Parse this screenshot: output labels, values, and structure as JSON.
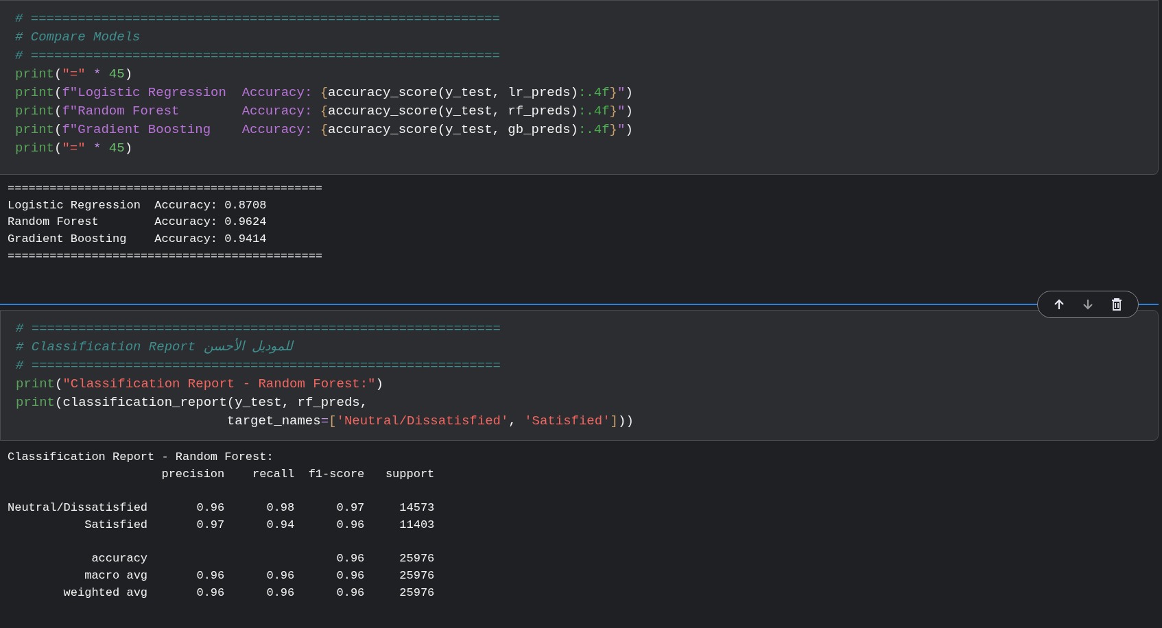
{
  "cells": [
    {
      "selected": false,
      "code": [
        [
          {
            "kind": "comment",
            "text": "# ============================================================"
          }
        ],
        [
          {
            "kind": "comment",
            "text": "# Compare Models"
          }
        ],
        [
          {
            "kind": "comment",
            "text": "# ============================================================"
          }
        ],
        [
          {
            "kind": "func",
            "text": "print"
          },
          {
            "kind": "plain",
            "text": "("
          },
          {
            "kind": "string",
            "text": "\"=\""
          },
          {
            "kind": "operator",
            "text": " * "
          },
          {
            "kind": "number",
            "text": "45"
          },
          {
            "kind": "plain",
            "text": ")"
          }
        ],
        [
          {
            "kind": "func",
            "text": "print"
          },
          {
            "kind": "plain",
            "text": "("
          },
          {
            "kind": "fstring",
            "text": "f\"Logistic Regression  Accuracy: "
          },
          {
            "kind": "brace",
            "text": "{"
          },
          {
            "kind": "plain",
            "text": "accuracy_score(y_test, lr_preds)"
          },
          {
            "kind": "format",
            "text": ":.4f"
          },
          {
            "kind": "brace",
            "text": "}"
          },
          {
            "kind": "fstring",
            "text": "\""
          },
          {
            "kind": "plain",
            "text": ")"
          }
        ],
        [
          {
            "kind": "func",
            "text": "print"
          },
          {
            "kind": "plain",
            "text": "("
          },
          {
            "kind": "fstring",
            "text": "f\"Random Forest        Accuracy: "
          },
          {
            "kind": "brace",
            "text": "{"
          },
          {
            "kind": "plain",
            "text": "accuracy_score(y_test, rf_preds)"
          },
          {
            "kind": "format",
            "text": ":.4f"
          },
          {
            "kind": "brace",
            "text": "}"
          },
          {
            "kind": "fstring",
            "text": "\""
          },
          {
            "kind": "plain",
            "text": ")"
          }
        ],
        [
          {
            "kind": "func",
            "text": "print"
          },
          {
            "kind": "plain",
            "text": "("
          },
          {
            "kind": "fstring",
            "text": "f\"Gradient Boosting    Accuracy: "
          },
          {
            "kind": "brace",
            "text": "{"
          },
          {
            "kind": "plain",
            "text": "accuracy_score(y_test, gb_preds)"
          },
          {
            "kind": "format",
            "text": ":.4f"
          },
          {
            "kind": "brace",
            "text": "}"
          },
          {
            "kind": "fstring",
            "text": "\""
          },
          {
            "kind": "plain",
            "text": ")"
          }
        ],
        [
          {
            "kind": "func",
            "text": "print"
          },
          {
            "kind": "plain",
            "text": "("
          },
          {
            "kind": "string",
            "text": "\"=\""
          },
          {
            "kind": "operator",
            "text": " * "
          },
          {
            "kind": "number",
            "text": "45"
          },
          {
            "kind": "plain",
            "text": ")"
          }
        ]
      ],
      "output": [
        [
          "=============================================",
          "Logistic Regression  Accuracy: 0.8708",
          "Random Forest        Accuracy: 0.9624",
          "Gradient Boosting    Accuracy: 0.9414",
          "============================================="
        ]
      ]
    },
    {
      "selected": true,
      "code": [
        [
          {
            "kind": "comment",
            "text": "# ============================================================"
          }
        ],
        [
          {
            "kind": "comment",
            "text": "# Classification Report للموديل الأحسن"
          }
        ],
        [
          {
            "kind": "comment",
            "text": "# ============================================================"
          }
        ],
        [
          {
            "kind": "func",
            "text": "print"
          },
          {
            "kind": "plain",
            "text": "("
          },
          {
            "kind": "string",
            "text": "\"Classification Report - Random Forest:\""
          },
          {
            "kind": "plain",
            "text": ")"
          }
        ],
        [
          {
            "kind": "func",
            "text": "print"
          },
          {
            "kind": "plain",
            "text": "(classification_report(y_test, rf_preds,"
          }
        ],
        [
          {
            "kind": "plain",
            "text": "                           target_names"
          },
          {
            "kind": "operator",
            "text": "="
          },
          {
            "kind": "brace",
            "text": "["
          },
          {
            "kind": "string",
            "text": "'Neutral/Dissatisfied'"
          },
          {
            "kind": "plain",
            "text": ", "
          },
          {
            "kind": "string",
            "text": "'Satisfied'"
          },
          {
            "kind": "brace",
            "text": "]"
          },
          {
            "kind": "plain",
            "text": "))"
          }
        ]
      ],
      "output": [
        [
          "Classification Report - Random Forest:",
          "                      precision    recall  f1-score   support"
        ],
        [
          "Neutral/Dissatisfied       0.96      0.98      0.97     14573",
          "           Satisfied       0.97      0.94      0.96     11403"
        ],
        [
          "            accuracy                           0.96     25976",
          "           macro avg       0.96      0.96      0.96     25976",
          "        weighted avg       0.96      0.96      0.96     25976"
        ]
      ]
    }
  ]
}
